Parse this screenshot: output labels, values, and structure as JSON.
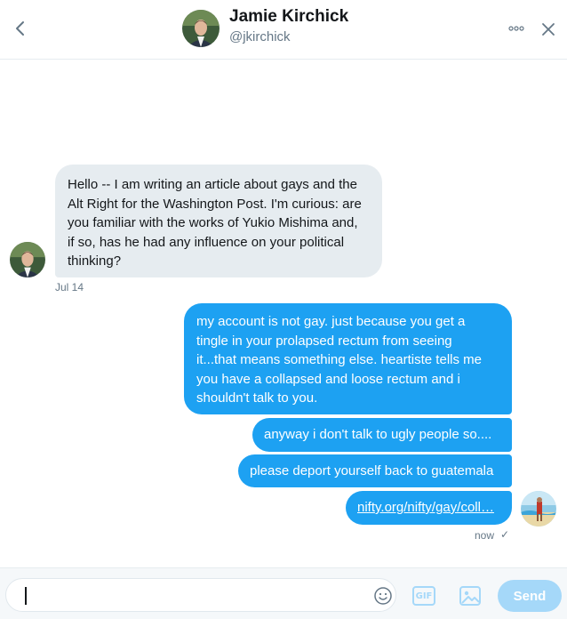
{
  "header": {
    "name": "Jamie Kirchick",
    "handle": "@jkirchick"
  },
  "messages": [
    {
      "direction": "incoming",
      "text": "Hello -- I am writing an article about gays and the\nAlt Right for the Washington Post. I'm curious: are\nyou familiar with the works of Yukio Mishima and,\nif so, has he had any influence on your political\nthinking?"
    },
    {
      "direction": "outgoing",
      "text": "my account is not gay. just because you get a\ntingle in your prolapsed rectum from seeing\nit...that means something else. heartiste tells me\nyou have a collapsed and loose rectum and i\nshouldn't talk to you."
    },
    {
      "direction": "outgoing",
      "text": "anyway i don't talk to ugly people so...."
    },
    {
      "direction": "outgoing",
      "text": "please deport yourself back to guatemala"
    },
    {
      "direction": "outgoing",
      "link": "nifty.org/nifty/gay/coll…"
    }
  ],
  "timestamps": {
    "incoming": "Jul 14",
    "outgoing": "now",
    "read_mark": "✓"
  },
  "composer": {
    "gif_label": "GIF",
    "send_label": "Send"
  },
  "colors": {
    "accent": "#1da1f2",
    "accent_disabled": "#a5d8f9",
    "incoming_bubble": "#e6ecf0",
    "secondary_text": "#657786"
  },
  "icons": {
    "back": "chevron-left-icon",
    "more": "more-dots-icon",
    "close": "close-icon",
    "emoji": "emoji-icon",
    "gif": "gif-icon",
    "media": "image-icon"
  }
}
